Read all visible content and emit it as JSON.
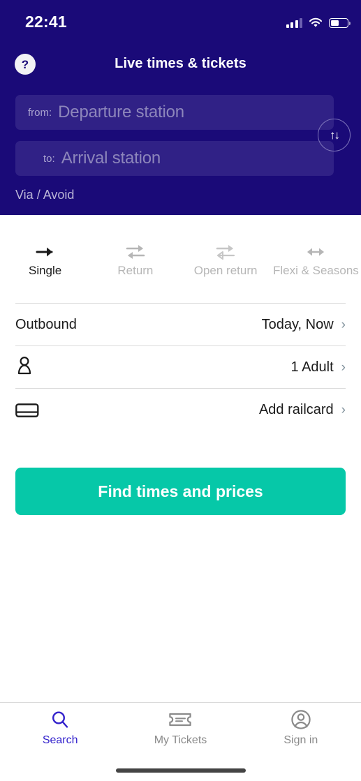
{
  "status_bar": {
    "time": "22:41",
    "battery_level": "52%"
  },
  "header": {
    "title": "Live times & tickets",
    "help_label": "?"
  },
  "search_form": {
    "from": {
      "label": "from:",
      "placeholder": "Departure station",
      "value": ""
    },
    "to": {
      "label": "to:",
      "placeholder": "Arrival station",
      "value": ""
    },
    "swap_label": "↑↓",
    "via_avoid": "Via / Avoid"
  },
  "ticket_types": [
    {
      "label": "Single",
      "icon": "arrow-right-icon",
      "active": true
    },
    {
      "label": "Return",
      "icon": "swap-arrows-icon",
      "active": false
    },
    {
      "label": "Open return",
      "icon": "open-swap-arrows-icon",
      "active": false
    },
    {
      "label": "Flexi & Seasons",
      "icon": "double-arrow-icon",
      "active": false
    }
  ],
  "options": [
    {
      "label": "Outbound",
      "value": "Today, Now",
      "icon": "",
      "chevron": "›"
    },
    {
      "label": "",
      "value": "1 Adult",
      "icon": "passenger-icon",
      "chevron": "›"
    },
    {
      "label": "",
      "value": "Add railcard",
      "icon": "railcard-icon",
      "chevron": "›"
    }
  ],
  "cta": {
    "label": "Find times and prices"
  },
  "bottom_nav": [
    {
      "label": "Search",
      "icon": "search-icon",
      "active": true
    },
    {
      "label": "My Tickets",
      "icon": "ticket-icon",
      "active": false
    },
    {
      "label": "Sign in",
      "icon": "account-icon",
      "active": false
    }
  ],
  "colors": {
    "navy": "#1A0A78",
    "field_fill": "#302186",
    "teal": "#06C8A8",
    "accent_blue": "#3322CC",
    "chevron_grey": "#7F909B"
  }
}
